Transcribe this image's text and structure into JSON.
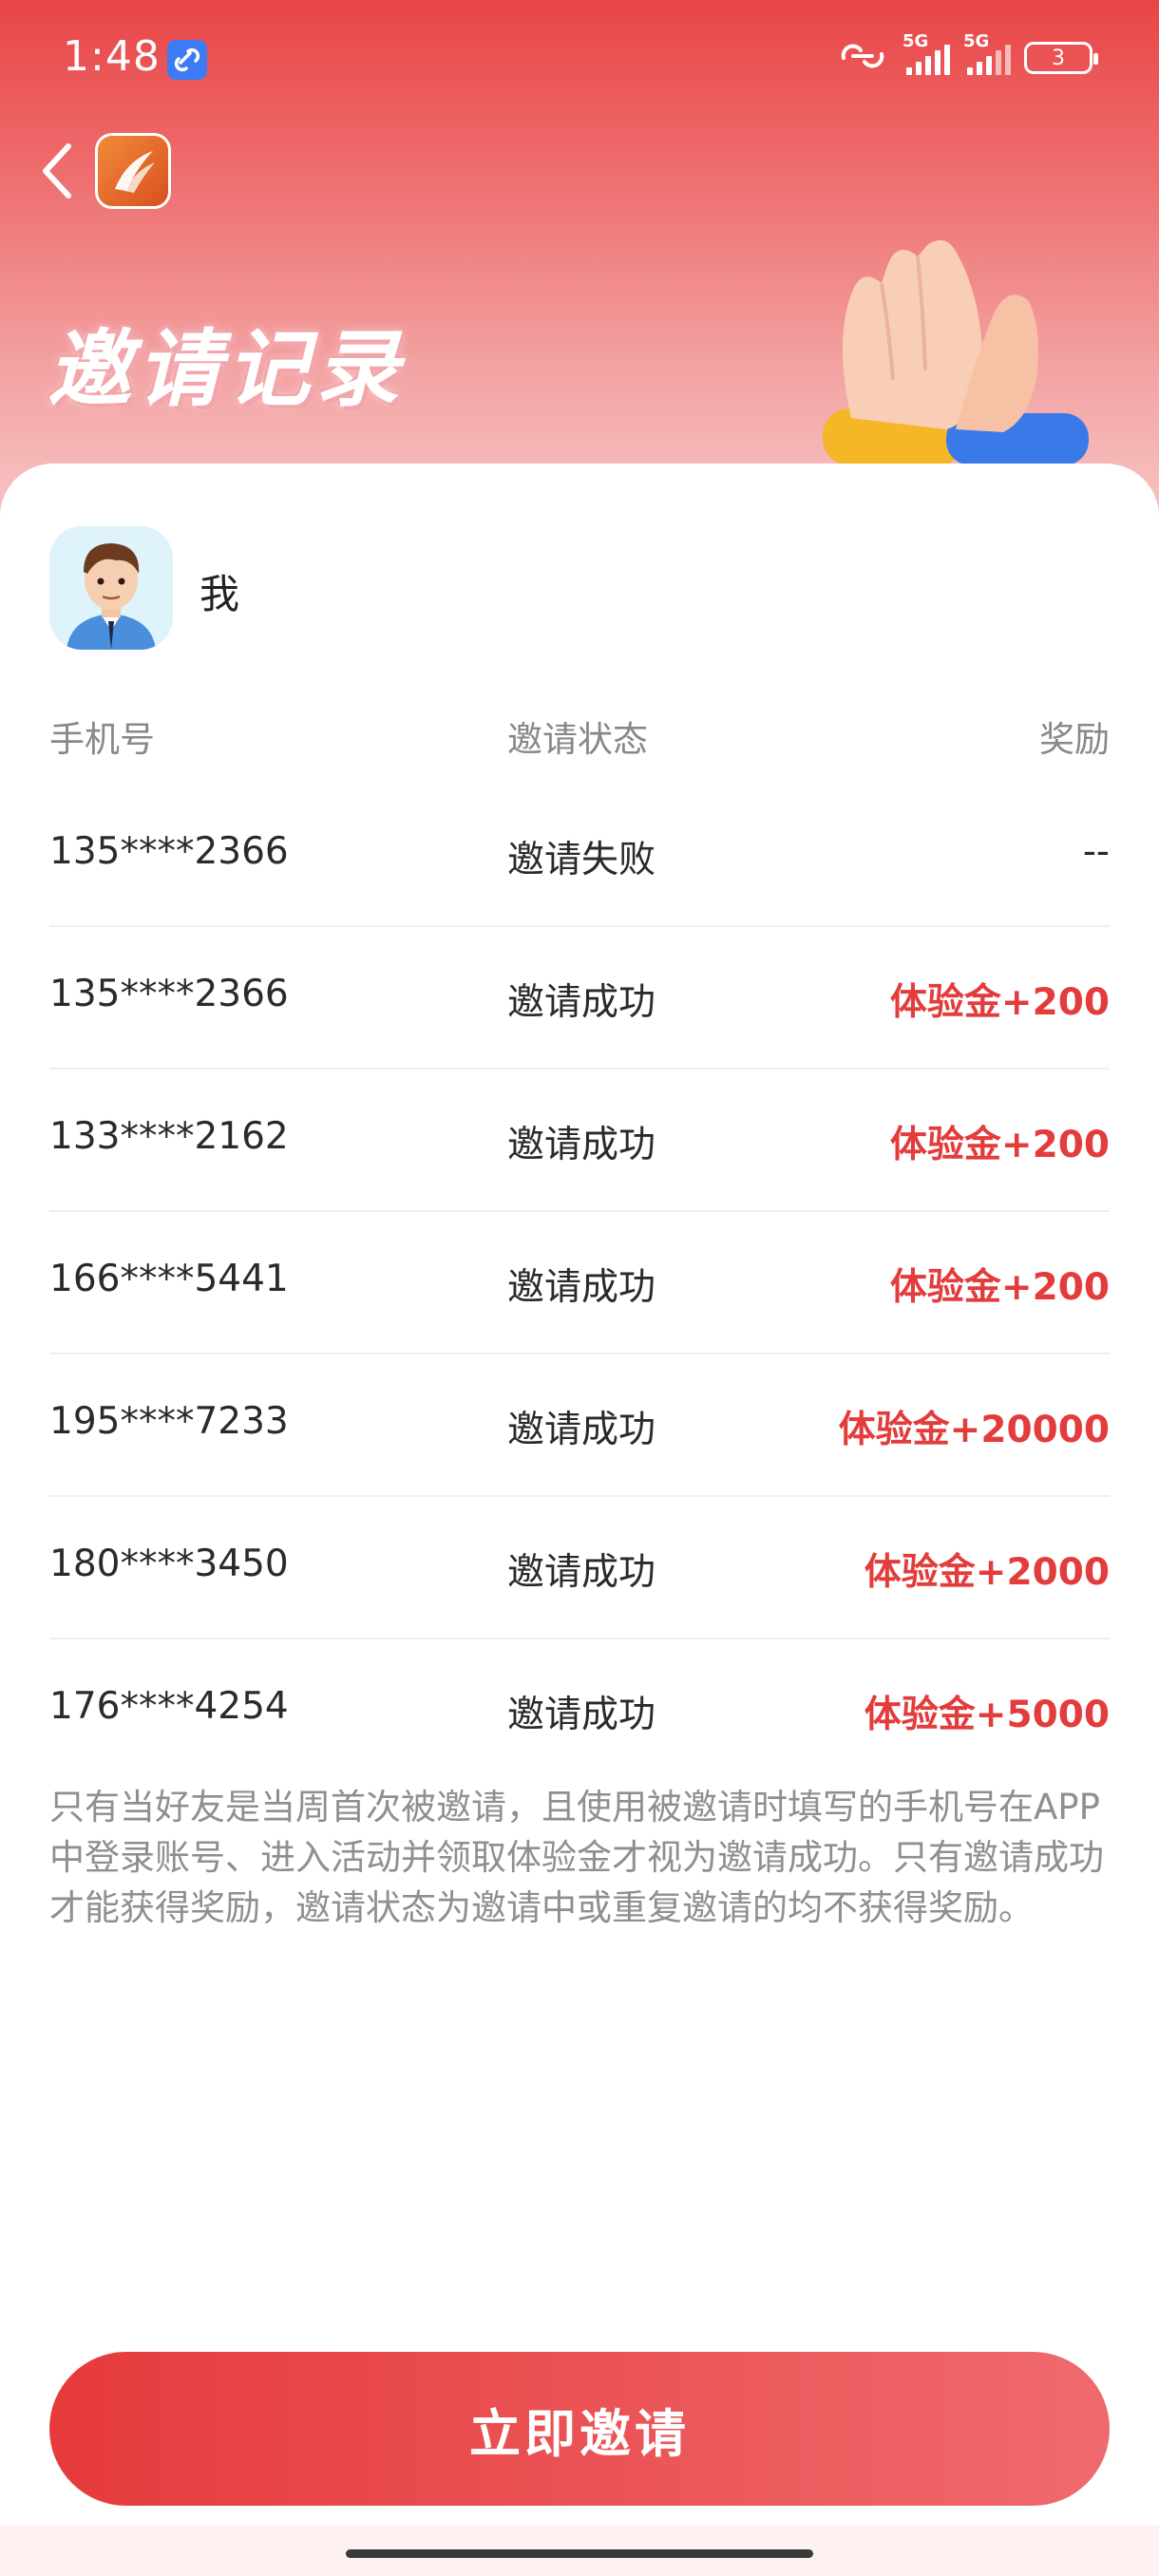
{
  "status_bar": {
    "time": "1:48",
    "network_1": "5G",
    "network_2": "5G",
    "battery": "3"
  },
  "header": {
    "title": "邀请记录"
  },
  "user": {
    "name": "我"
  },
  "table": {
    "columns": [
      "手机号",
      "邀请状态",
      "奖励"
    ],
    "rows": [
      {
        "phone": "135****2366",
        "status": "邀请失败",
        "reward": "--"
      },
      {
        "phone": "135****2366",
        "status": "邀请成功",
        "reward": "体验金+200"
      },
      {
        "phone": "133****2162",
        "status": "邀请成功",
        "reward": "体验金+200"
      },
      {
        "phone": "166****5441",
        "status": "邀请成功",
        "reward": "体验金+200"
      },
      {
        "phone": "195****7233",
        "status": "邀请成功",
        "reward": "体验金+20000"
      },
      {
        "phone": "180****3450",
        "status": "邀请成功",
        "reward": "体验金+2000"
      },
      {
        "phone": "176****4254",
        "status": "邀请成功",
        "reward": "体验金+5000"
      }
    ]
  },
  "notice": "只有当好友是当周首次被邀请，且使用被邀请时填写的手机号在APP中登录账号、进入活动并领取体验金才视为邀请成功。只有邀请成功才能获得奖励，邀请状态为邀请中或重复邀请的均不获得奖励。",
  "invite_button": "立即邀请",
  "colors": {
    "accent": "#e63a3c",
    "reward_text": "#e23c3c"
  }
}
